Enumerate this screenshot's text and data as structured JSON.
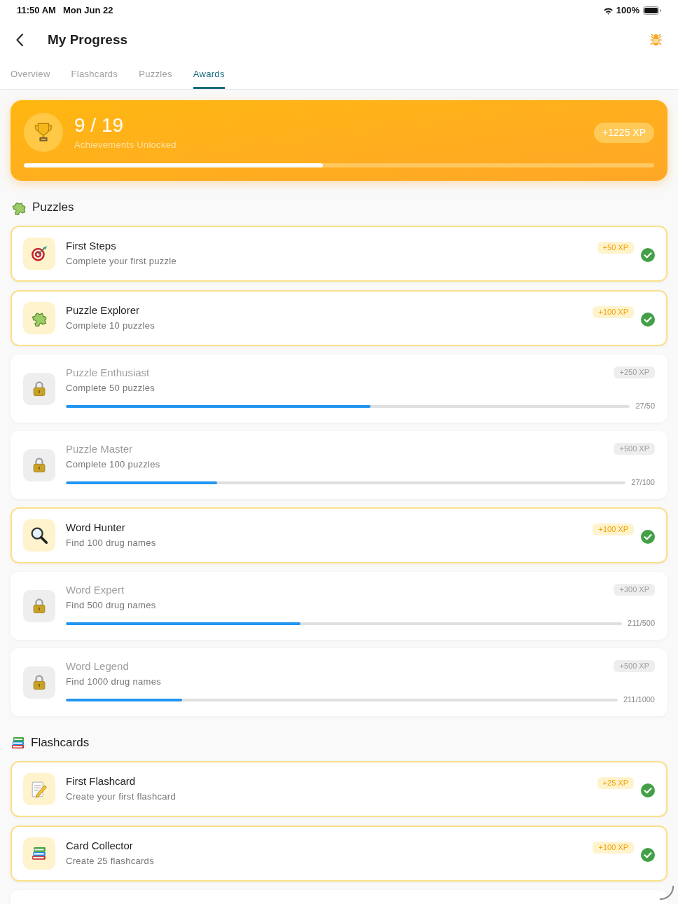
{
  "status_bar": {
    "time": "11:50 AM",
    "date": "Mon Jun 22",
    "battery": "100%"
  },
  "header": {
    "title": "My Progress"
  },
  "tabs": [
    {
      "label": "Overview",
      "selected": false
    },
    {
      "label": "Flashcards",
      "selected": false
    },
    {
      "label": "Puzzles",
      "selected": false
    },
    {
      "label": "Awards",
      "selected": true
    }
  ],
  "summary": {
    "count": "9 / 19",
    "caption": "Achievements Unlocked",
    "xp": "+1225 XP",
    "level": 0.474
  },
  "sections": [
    {
      "title": "Puzzles",
      "achievements": [
        {
          "title": "First Steps",
          "description": "Complete your first puzzle",
          "xp": "+50 XP",
          "unlocked": true
        },
        {
          "title": "Puzzle Explorer",
          "description": "Complete 10 puzzles",
          "xp": "+100 XP",
          "unlocked": true
        },
        {
          "title": "Puzzle Enthusiast",
          "description": "Complete 50 puzzles",
          "xp": "+250 XP",
          "unlocked": false,
          "level": 0.54,
          "reading": "27/50"
        },
        {
          "title": "Puzzle Master",
          "description": "Complete 100 puzzles",
          "xp": "+500 XP",
          "unlocked": false,
          "level": 0.27,
          "reading": "27/100"
        },
        {
          "title": "Word Hunter",
          "description": "Find 100 drug names",
          "xp": "+100 XP",
          "unlocked": true
        },
        {
          "title": "Word Expert",
          "description": "Find 500 drug names",
          "xp": "+300 XP",
          "unlocked": false,
          "level": 0.422,
          "reading": "211/500"
        },
        {
          "title": "Word Legend",
          "description": "Find 1000 drug names",
          "xp": "+500 XP",
          "unlocked": false,
          "level": 0.211,
          "reading": "211/1000"
        }
      ]
    },
    {
      "title": "Flashcards",
      "achievements": [
        {
          "title": "First Flashcard",
          "description": "Create your first flashcard",
          "xp": "+25 XP",
          "unlocked": true
        },
        {
          "title": "Card Collector",
          "description": "Create 25 flashcards",
          "xp": "+100 XP",
          "unlocked": true
        }
      ]
    }
  ]
}
